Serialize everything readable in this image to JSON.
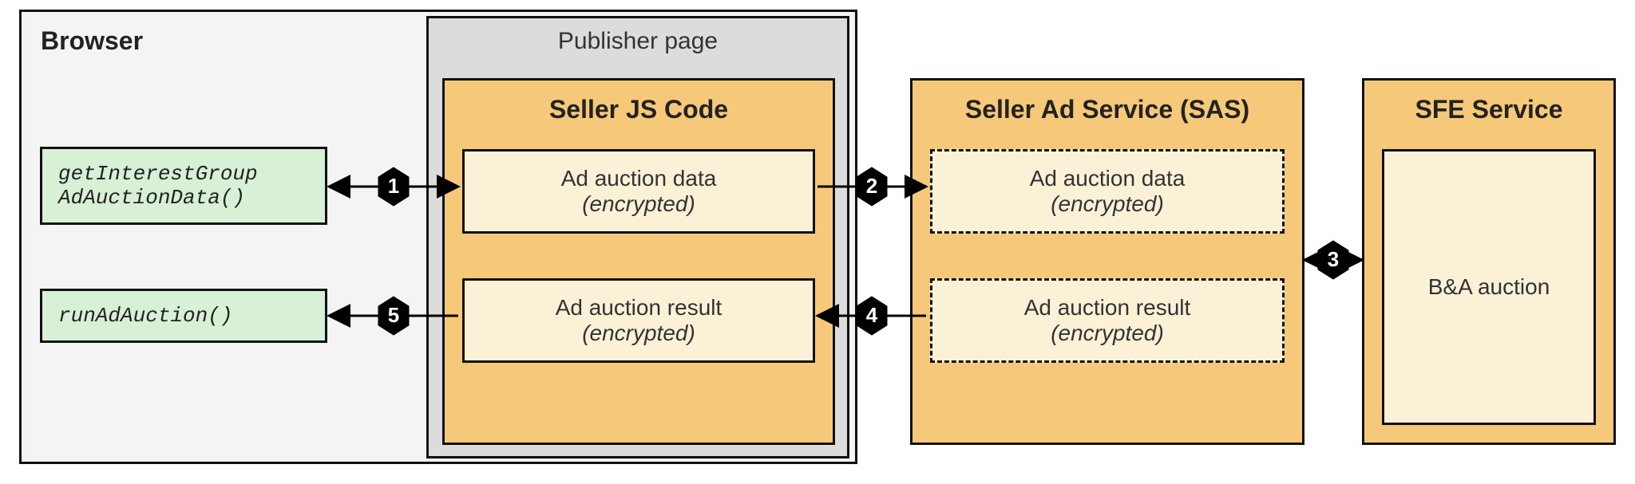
{
  "browser": {
    "label": "Browser"
  },
  "pub": {
    "label": "Publisher page"
  },
  "seller_js": {
    "title": "Seller JS Code",
    "data_label": "Ad auction data",
    "data_enc": "(encrypted)",
    "result_label": "Ad auction result",
    "result_enc": "(encrypted)"
  },
  "sas": {
    "title": "Seller Ad Service (SAS)",
    "data_label": "Ad auction data",
    "data_enc": "(encrypted)",
    "result_label": "Ad auction result",
    "result_enc": "(encrypted)"
  },
  "sfe": {
    "title": "SFE Service",
    "body": "B&A auction"
  },
  "api": {
    "getIG_l1": "getInterestGroup",
    "getIG_l2": "AdAuctionData()",
    "runAd": "runAdAuction()"
  },
  "steps": {
    "s1": "1",
    "s2": "2",
    "s3": "3",
    "s4": "4",
    "s5": "5"
  }
}
